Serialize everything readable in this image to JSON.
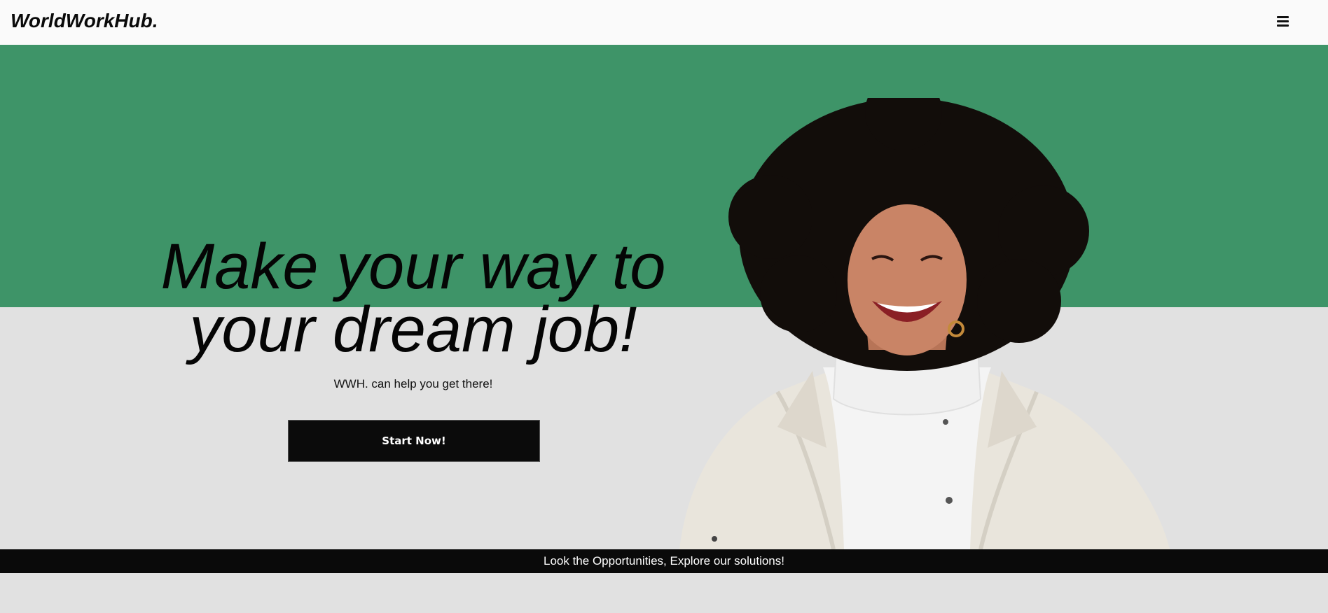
{
  "header": {
    "logo": "WorldWorkHub.",
    "menu_icon": "hamburger-menu-icon"
  },
  "hero": {
    "headline": "Make your way to your dream job!",
    "subtitle": "WWH. can help you get there!",
    "cta_label": "Start Now!",
    "image": "smiling-woman-curly-hair-photo"
  },
  "ticker": {
    "text": "Look the Opportunities, Explore our solutions!"
  },
  "colors": {
    "green_band": "#3e9468",
    "grey_band": "#e1e1e1",
    "navbar": "#fafafa",
    "dark": "#0a0a0a"
  }
}
